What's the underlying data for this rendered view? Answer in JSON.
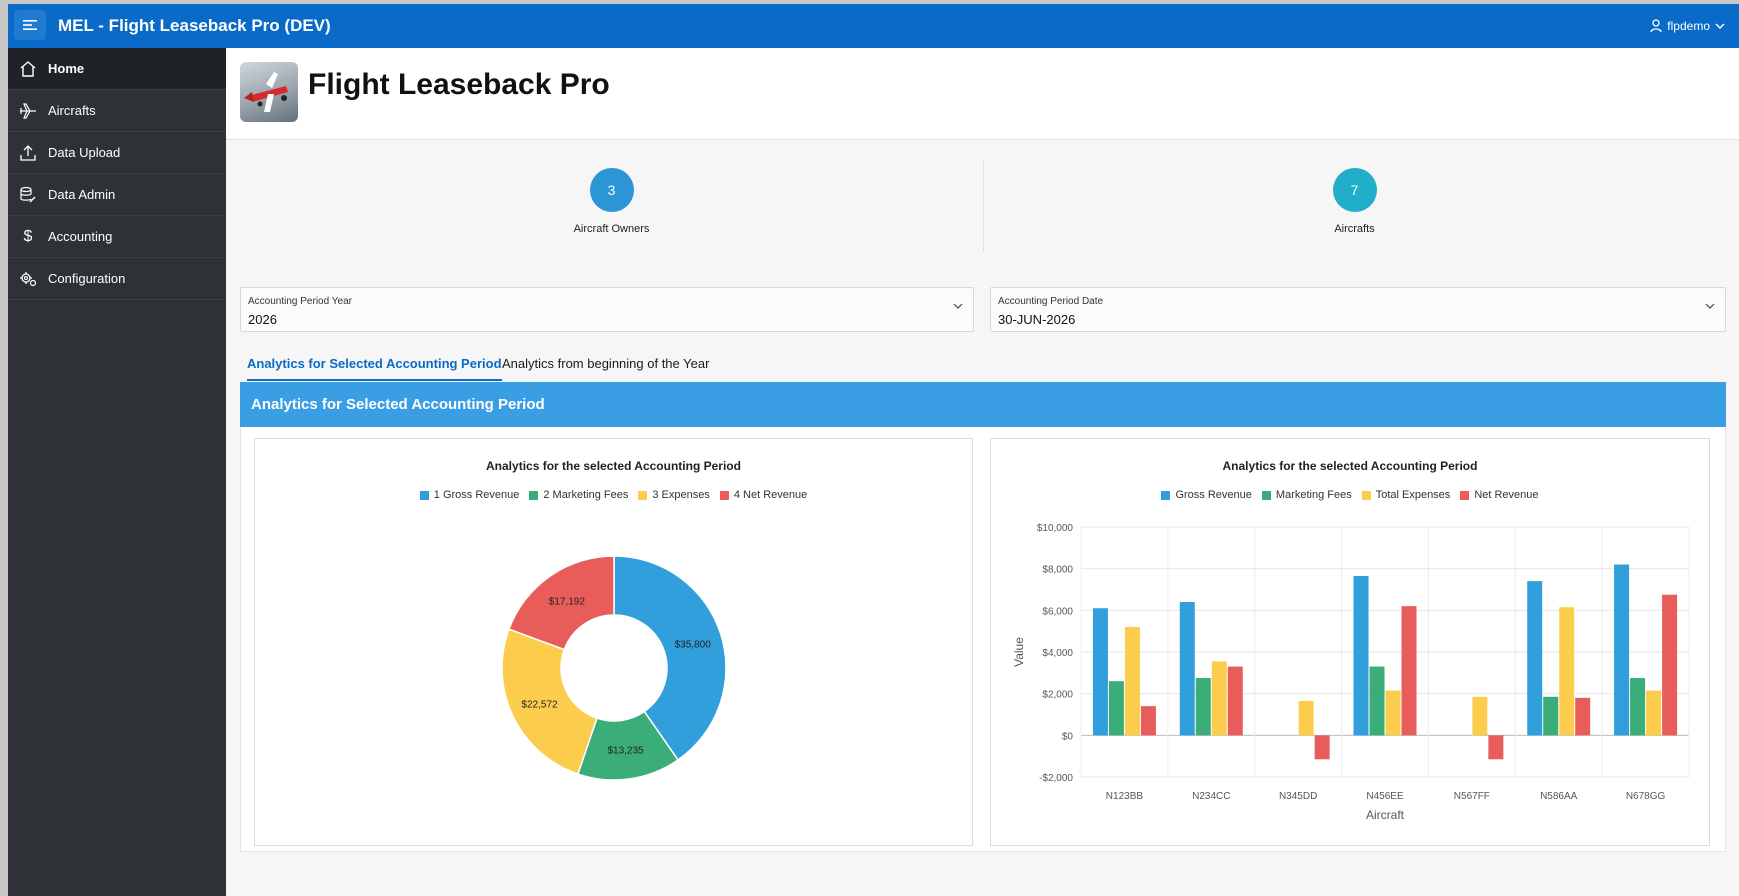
{
  "app": {
    "title": "MEL - Flight Leaseback Pro (DEV)",
    "user": "flpdemo"
  },
  "sidebar": {
    "items": [
      {
        "label": "Home",
        "icon": "home-icon",
        "active": true
      },
      {
        "label": "Aircrafts",
        "icon": "airplane-icon",
        "active": false
      },
      {
        "label": "Data Upload",
        "icon": "upload-icon",
        "active": false
      },
      {
        "label": "Data Admin",
        "icon": "database-edit-icon",
        "active": false
      },
      {
        "label": "Accounting",
        "icon": "dollar-icon",
        "active": false
      },
      {
        "label": "Configuration",
        "icon": "gears-icon",
        "active": false
      }
    ]
  },
  "page": {
    "title": "Flight Leaseback Pro"
  },
  "metrics": [
    {
      "value": "3",
      "label": "Aircraft Owners",
      "color": "#2b95d6"
    },
    {
      "value": "7",
      "label": "Aircrafts",
      "color": "#21aecb"
    }
  ],
  "filters": {
    "year": {
      "label": "Accounting Period Year",
      "value": "2026"
    },
    "date": {
      "label": "Accounting Period Date",
      "value": "30-JUN-2026"
    }
  },
  "tabs": [
    {
      "label": "Analytics for Selected Accounting Period",
      "active": true
    },
    {
      "label": "Analytics from beginning of the Year",
      "active": false
    }
  ],
  "region": {
    "title": "Analytics for Selected Accounting Period"
  },
  "colors": {
    "topbar": "#0a6ac7",
    "gross": "#309fdb",
    "marketing": "#3aad78",
    "expenses": "#fccd4d",
    "net": "#e85d5a"
  },
  "chart_data": [
    {
      "type": "pie",
      "title": "Analytics for the selected Accounting Period",
      "legend_position": "top",
      "categories": [
        "1 Gross Revenue",
        "2 Marketing Fees",
        "3 Expenses",
        "4 Net Revenue"
      ],
      "values": [
        35800,
        13235,
        22572,
        17192
      ],
      "data_labels": [
        "$35,800",
        "$13,235",
        "$22,572",
        "$17,192"
      ],
      "colors": [
        "#309fdb",
        "#3aad78",
        "#fccd4d",
        "#e85d5a"
      ]
    },
    {
      "type": "bar",
      "title": "Analytics for the selected Accounting Period",
      "legend_position": "top",
      "xlabel": "Aircraft",
      "ylabel": "Value",
      "ylim": [
        -2000,
        10000
      ],
      "yticks": [
        10000,
        8000,
        6000,
        4000,
        2000,
        0,
        -2000
      ],
      "ytick_labels": [
        "$10,000",
        "$8,000",
        "$6,000",
        "$4,000",
        "$2,000",
        "$0",
        "-$2,000"
      ],
      "grid": true,
      "categories": [
        "N123BB",
        "N234CC",
        "N345DD",
        "N456EE",
        "N567FF",
        "N586AA",
        "N678GG"
      ],
      "series": [
        {
          "name": "Gross Revenue",
          "color": "#309fdb",
          "values": [
            6100,
            6400,
            0,
            7650,
            0,
            7400,
            8200
          ]
        },
        {
          "name": "Marketing Fees",
          "color": "#3aad78",
          "values": [
            2600,
            2750,
            0,
            3300,
            0,
            1850,
            2750
          ]
        },
        {
          "name": "Total Expenses",
          "color": "#fccd4d",
          "values": [
            5200,
            3550,
            1650,
            2150,
            1850,
            6150,
            2150
          ]
        },
        {
          "name": "Net Revenue",
          "color": "#e85d5a",
          "values": [
            1400,
            3300,
            -1150,
            6200,
            -1150,
            1800,
            6750
          ]
        }
      ]
    }
  ]
}
